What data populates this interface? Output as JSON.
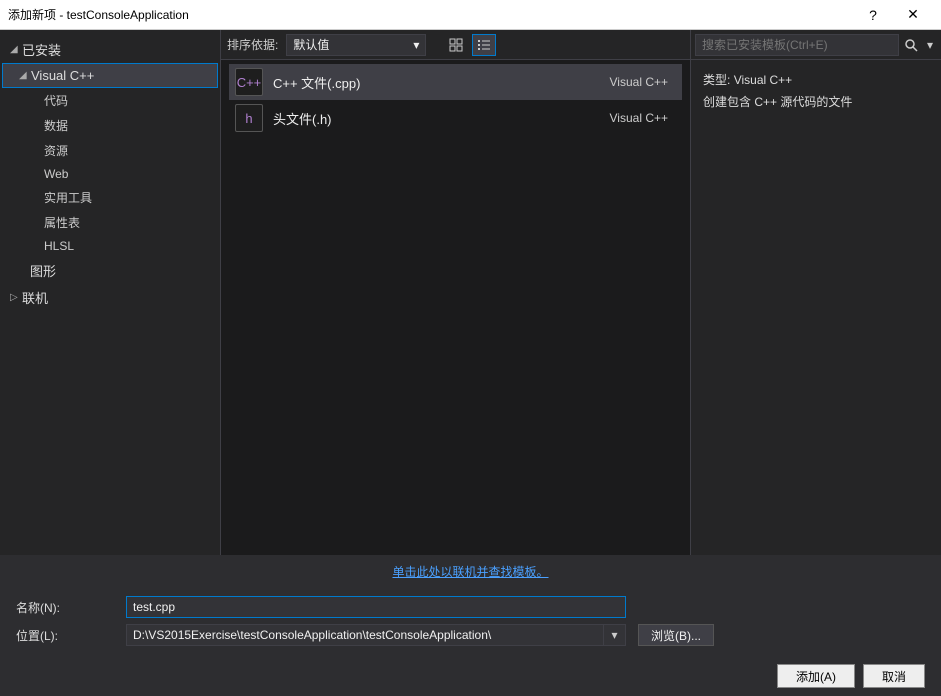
{
  "window": {
    "title": "添加新项 - testConsoleApplication",
    "help": "?",
    "close": "✕"
  },
  "sidebar": {
    "installed": "已安装",
    "visualcpp": "Visual C++",
    "items": [
      "代码",
      "数据",
      "资源",
      "Web",
      "实用工具",
      "属性表",
      "HLSL"
    ],
    "graphics": "图形",
    "online": "联机"
  },
  "toolbar": {
    "sort_label": "排序依据:",
    "sort_value": "默认值"
  },
  "templates": [
    {
      "icon": "C++",
      "label": "C++ 文件(.cpp)",
      "lang": "Visual C++",
      "selected": true
    },
    {
      "icon": "h",
      "label": "头文件(.h)",
      "lang": "Visual C++",
      "selected": false
    }
  ],
  "search": {
    "placeholder": "搜索已安装模板(Ctrl+E)"
  },
  "details": {
    "type_label": "类型:",
    "type_value": "Visual C++",
    "description": "创建包含 C++ 源代码的文件"
  },
  "link": "单击此处以联机并查找模板。",
  "fields": {
    "name_label": "名称(N):",
    "name_value": "test.cpp",
    "location_label": "位置(L):",
    "location_value": "D:\\VS2015Exercise\\testConsoleApplication\\testConsoleApplication\\",
    "browse": "浏览(B)..."
  },
  "actions": {
    "add": "添加(A)",
    "cancel": "取消"
  }
}
